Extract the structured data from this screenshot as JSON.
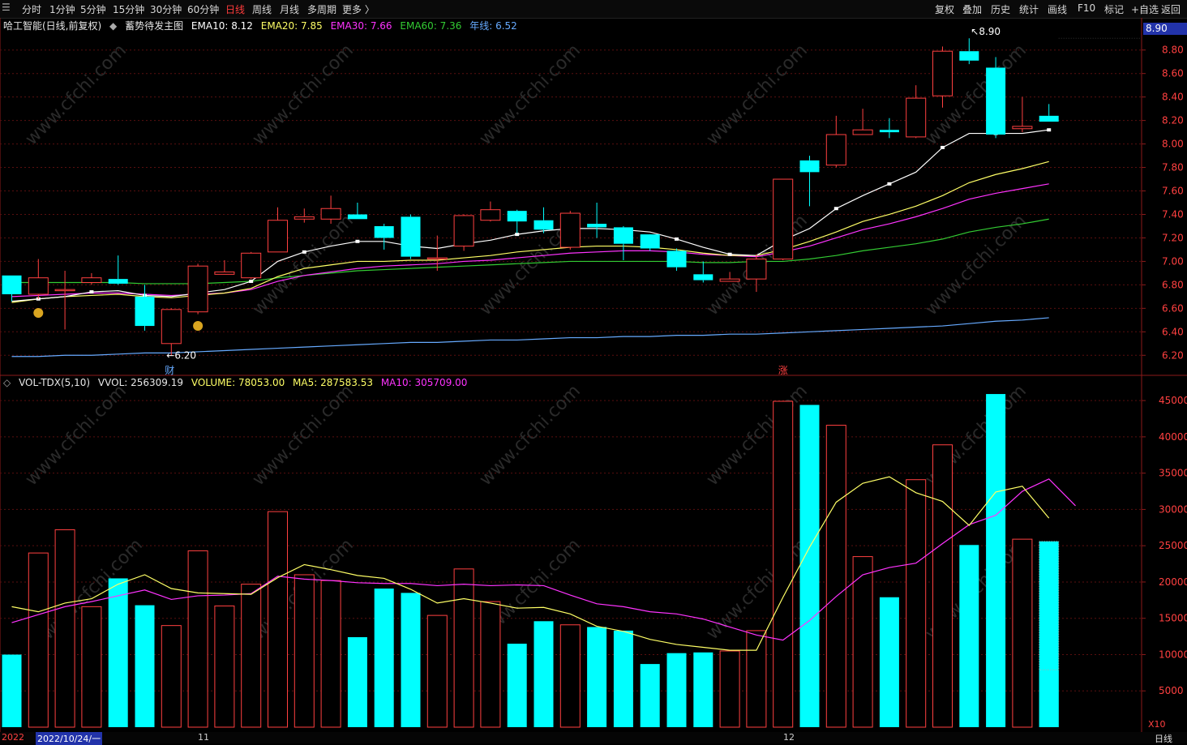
{
  "toolbar": {
    "left_items": [
      "分时",
      "1分钟",
      "5分钟",
      "15分钟",
      "30分钟",
      "60分钟",
      "日线",
      "周线",
      "月线",
      "多周期",
      "更多 〉"
    ],
    "active": "日线",
    "right_items": [
      "复权",
      "叠加",
      "历史",
      "统计",
      "画线",
      "F10",
      "标记",
      "+自选",
      "返回"
    ]
  },
  "legend": {
    "stock": "哈工智能(日线,前复权)",
    "indicator": "蓄势待发主图",
    "ema10": "EMA10: 8.12",
    "ema20": "EMA20: 7.85",
    "ema30": "EMA30: 7.66",
    "ema60": "EMA60: 7.36",
    "year": "年线: 6.52"
  },
  "vol_legend": {
    "name": "VOL-TDX(5,10)",
    "vvol": "VVOL: 256309.19",
    "volume": "VOLUME: 78053.00",
    "ma5": "MA5: 287583.53",
    "ma10": "MA10: 305709.00"
  },
  "current_price": "8.90",
  "markers": {
    "cai": "财",
    "zhang": "涨",
    "high_label": "8.90",
    "low_label": "6.20",
    "x10": "X10",
    "period": "日线"
  },
  "dates": {
    "year": "2022",
    "first": "2022/10/24/一",
    "nov": "11",
    "dec": "12"
  },
  "colors": {
    "up": "#ff4040",
    "down": "#00ffff",
    "ema10": "#ffffff",
    "ema20": "#ffff66",
    "ema30": "#ff33ff",
    "ema60": "#33cc33",
    "year": "#66aaff"
  },
  "chart_data": [
    {
      "type": "candlestick",
      "title": "",
      "ylim": [
        6.05,
        8.95
      ],
      "yticks": [
        6.2,
        6.4,
        6.6,
        6.8,
        7.0,
        7.2,
        7.4,
        7.6,
        7.8,
        8.0,
        8.2,
        8.4,
        8.6,
        8.8
      ],
      "candles": [
        {
          "o": 6.88,
          "c": 6.72,
          "h": 6.88,
          "l": 6.66
        },
        {
          "o": 6.72,
          "c": 6.86,
          "h": 7.02,
          "l": 6.68
        },
        {
          "o": 6.76,
          "c": 6.76,
          "h": 6.92,
          "l": 6.42
        },
        {
          "o": 6.82,
          "c": 6.86,
          "h": 6.9,
          "l": 6.8
        },
        {
          "o": 6.85,
          "c": 6.81,
          "h": 7.05,
          "l": 6.8
        },
        {
          "o": 6.7,
          "c": 6.45,
          "h": 6.8,
          "l": 6.41
        },
        {
          "o": 6.3,
          "c": 6.59,
          "h": 6.6,
          "l": 6.2
        },
        {
          "o": 6.57,
          "c": 6.96,
          "h": 6.98,
          "l": 6.55
        },
        {
          "o": 6.89,
          "c": 6.91,
          "h": 7.01,
          "l": 6.89
        },
        {
          "o": 6.86,
          "c": 7.07,
          "h": 7.08,
          "l": 6.85
        },
        {
          "o": 7.08,
          "c": 7.35,
          "h": 7.46,
          "l": 7.08
        },
        {
          "o": 7.36,
          "c": 7.38,
          "h": 7.45,
          "l": 7.33
        },
        {
          "o": 7.36,
          "c": 7.45,
          "h": 7.56,
          "l": 7.32
        },
        {
          "o": 7.4,
          "c": 7.36,
          "h": 7.5,
          "l": 7.36
        },
        {
          "o": 7.3,
          "c": 7.2,
          "h": 7.32,
          "l": 7.1
        },
        {
          "o": 7.38,
          "c": 7.04,
          "h": 7.4,
          "l": 7.02
        },
        {
          "o": 7.02,
          "c": 7.03,
          "h": 7.22,
          "l": 6.92
        },
        {
          "o": 7.13,
          "c": 7.39,
          "h": 7.4,
          "l": 7.09
        },
        {
          "o": 7.35,
          "c": 7.44,
          "h": 7.51,
          "l": 7.34
        },
        {
          "o": 7.43,
          "c": 7.34,
          "h": 7.44,
          "l": 7.24
        },
        {
          "o": 7.35,
          "c": 7.27,
          "h": 7.46,
          "l": 7.24
        },
        {
          "o": 7.12,
          "c": 7.41,
          "h": 7.43,
          "l": 7.1
        },
        {
          "o": 7.32,
          "c": 7.29,
          "h": 7.5,
          "l": 7.2
        },
        {
          "o": 7.29,
          "c": 7.15,
          "h": 7.3,
          "l": 7.01
        },
        {
          "o": 7.23,
          "c": 7.11,
          "h": 7.22,
          "l": 7.09
        },
        {
          "o": 7.09,
          "c": 6.95,
          "h": 7.11,
          "l": 6.92
        },
        {
          "o": 6.89,
          "c": 6.84,
          "h": 7.0,
          "l": 6.82
        },
        {
          "o": 6.83,
          "c": 6.85,
          "h": 6.91,
          "l": 6.83
        },
        {
          "o": 6.85,
          "c": 7.02,
          "h": 7.06,
          "l": 6.74
        },
        {
          "o": 7.02,
          "c": 7.7,
          "h": 7.7,
          "l": 7.01
        },
        {
          "o": 7.86,
          "c": 7.76,
          "h": 7.9,
          "l": 7.47
        },
        {
          "o": 7.82,
          "c": 8.08,
          "h": 8.24,
          "l": 7.8
        },
        {
          "o": 8.08,
          "c": 8.12,
          "h": 8.3,
          "l": 8.08
        },
        {
          "o": 8.12,
          "c": 8.1,
          "h": 8.22,
          "l": 8.05
        },
        {
          "o": 8.06,
          "c": 8.39,
          "h": 8.5,
          "l": 8.05
        },
        {
          "o": 8.41,
          "c": 8.79,
          "h": 8.83,
          "l": 8.31
        },
        {
          "o": 8.79,
          "c": 8.71,
          "h": 8.9,
          "l": 8.68
        },
        {
          "o": 8.65,
          "c": 8.08,
          "h": 8.74,
          "l": 8.05
        },
        {
          "o": 8.13,
          "c": 8.15,
          "h": 8.4,
          "l": 8.1
        },
        {
          "o": 8.24,
          "c": 8.19,
          "h": 8.34,
          "l": 8.19
        }
      ],
      "ema10": [
        6.66,
        6.68,
        6.7,
        6.74,
        6.75,
        6.71,
        6.7,
        6.73,
        6.76,
        6.83,
        7.0,
        7.08,
        7.13,
        7.17,
        7.17,
        7.13,
        7.11,
        7.15,
        7.18,
        7.23,
        7.26,
        7.28,
        7.28,
        7.27,
        7.25,
        7.19,
        7.12,
        7.06,
        7.05,
        7.18,
        7.28,
        7.45,
        7.56,
        7.66,
        7.76,
        7.97,
        8.09,
        8.09,
        8.09,
        8.12
      ],
      "ema20": [
        6.65,
        6.68,
        6.7,
        6.71,
        6.72,
        6.7,
        6.69,
        6.71,
        6.73,
        6.77,
        6.87,
        6.94,
        6.97,
        7.0,
        7.0,
        7.01,
        7.01,
        7.03,
        7.05,
        7.08,
        7.1,
        7.12,
        7.13,
        7.13,
        7.12,
        7.1,
        7.07,
        7.05,
        7.05,
        7.1,
        7.17,
        7.25,
        7.34,
        7.4,
        7.47,
        7.56,
        7.67,
        7.74,
        7.79,
        7.85
      ],
      "ema30": [
        6.7,
        6.71,
        6.72,
        6.73,
        6.73,
        6.72,
        6.71,
        6.72,
        6.73,
        6.76,
        6.83,
        6.88,
        6.91,
        6.94,
        6.96,
        6.97,
        6.98,
        7.0,
        7.01,
        7.03,
        7.05,
        7.07,
        7.08,
        7.09,
        7.09,
        7.08,
        7.06,
        7.05,
        7.04,
        7.08,
        7.13,
        7.2,
        7.27,
        7.32,
        7.38,
        7.45,
        7.53,
        7.58,
        7.62,
        7.66
      ],
      "ema60": [
        6.82,
        6.82,
        6.82,
        6.82,
        6.82,
        6.81,
        6.81,
        6.81,
        6.82,
        6.83,
        6.86,
        6.88,
        6.9,
        6.92,
        6.93,
        6.94,
        6.95,
        6.96,
        6.97,
        6.98,
        6.99,
        7.0,
        7.0,
        7.0,
        7.0,
        7.0,
        6.99,
        6.99,
        7.0,
        7.0,
        7.02,
        7.05,
        7.09,
        7.12,
        7.15,
        7.19,
        7.25,
        7.29,
        7.32,
        7.36
      ],
      "year_line": [
        6.19,
        6.19,
        6.2,
        6.2,
        6.21,
        6.22,
        6.22,
        6.23,
        6.24,
        6.25,
        6.26,
        6.27,
        6.28,
        6.29,
        6.3,
        6.31,
        6.31,
        6.32,
        6.33,
        6.33,
        6.34,
        6.35,
        6.35,
        6.36,
        6.36,
        6.37,
        6.37,
        6.38,
        6.38,
        6.39,
        6.4,
        6.41,
        6.42,
        6.43,
        6.44,
        6.45,
        6.47,
        6.49,
        6.5,
        6.52
      ]
    },
    {
      "type": "bar",
      "title": "",
      "ylim": [
        0,
        46800
      ],
      "yticks": [
        5000,
        10000,
        15000,
        20000,
        25000,
        30000,
        35000,
        40000,
        45000
      ],
      "volumes": [
        10000,
        24000,
        27200,
        16600,
        20500,
        16800,
        14000,
        24300,
        16700,
        19700,
        29700,
        21000,
        20200,
        12400,
        19100,
        18500,
        15400,
        21800,
        17300,
        11500,
        14600,
        14100,
        13800,
        13300,
        8700,
        10200,
        10300,
        10500,
        13300,
        44900,
        44400,
        41600,
        23500,
        17900,
        34100,
        38900,
        25100,
        45900,
        25900,
        25600
      ],
      "up": [
        false,
        true,
        true,
        true,
        false,
        false,
        true,
        true,
        true,
        true,
        true,
        true,
        true,
        false,
        false,
        false,
        true,
        true,
        true,
        false,
        false,
        true,
        false,
        false,
        false,
        false,
        false,
        true,
        true,
        true,
        false,
        true,
        true,
        false,
        true,
        true,
        false,
        false,
        true,
        false
      ],
      "today_partial_volume": 7900,
      "ma5": [
        16600,
        15900,
        17100,
        17700,
        19700,
        21000,
        19100,
        18500,
        18400,
        18300,
        20600,
        22400,
        21700,
        20900,
        20500,
        19000,
        17100,
        17700,
        17100,
        16400,
        16500,
        15600,
        13900,
        13200,
        12100,
        11400,
        11000,
        10600,
        10600,
        17900,
        24800,
        31000,
        33600,
        34500,
        32300,
        31100,
        27800,
        32400,
        33200,
        28800
      ],
      "ma10": [
        14400,
        15500,
        16600,
        17300,
        18100,
        18900,
        17600,
        18100,
        18200,
        18400,
        20800,
        20400,
        20200,
        19900,
        19800,
        19800,
        19500,
        19700,
        19500,
        19600,
        19500,
        18200,
        17000,
        16600,
        15900,
        15600,
        14900,
        13800,
        12700,
        12000,
        14700,
        18000,
        21000,
        22000,
        22600,
        25300,
        27900,
        29200,
        32500,
        34200,
        30500
      ]
    }
  ]
}
